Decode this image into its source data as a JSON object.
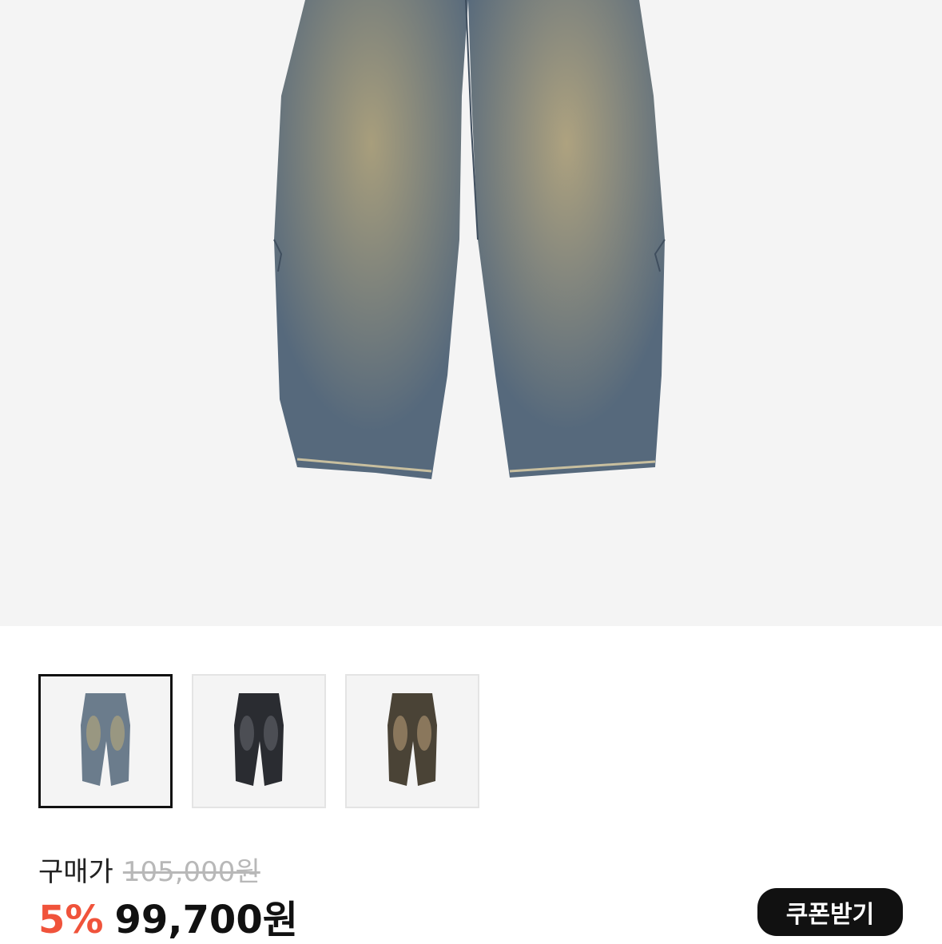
{
  "product": {
    "image_alt": "denim-pants-main-image",
    "thumbnails": [
      {
        "name": "light-wash",
        "color": "#6b7c8c",
        "selected": true
      },
      {
        "name": "black-wash",
        "color": "#2a2c31",
        "selected": false
      },
      {
        "name": "brown-wash",
        "color": "#5b5142",
        "selected": false
      }
    ]
  },
  "pricing": {
    "label": "구매가",
    "original_price": "105,000원",
    "discount": "5%",
    "sale_price": "99,700원",
    "discount_color": "#f0533b"
  },
  "coupon": {
    "label": "쿠폰받기"
  }
}
